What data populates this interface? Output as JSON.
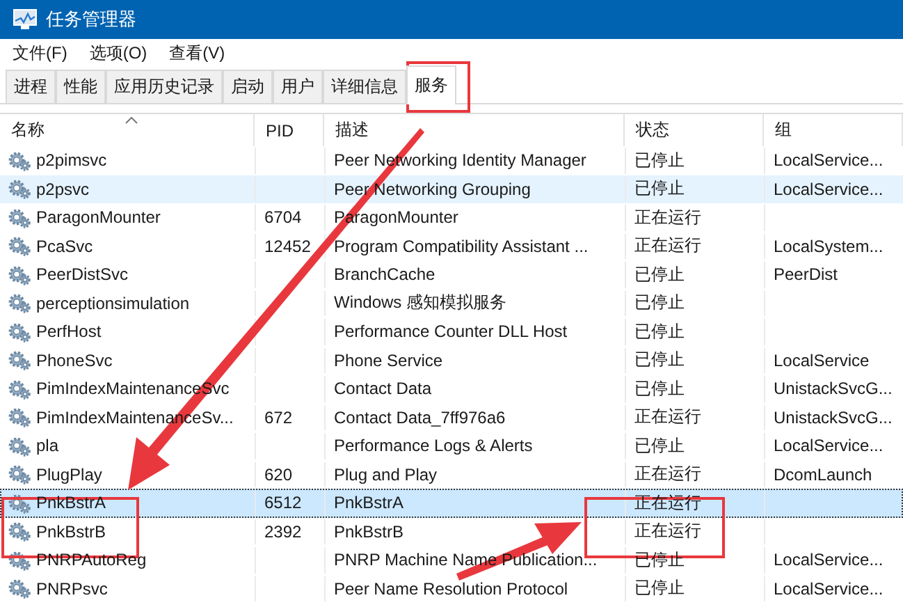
{
  "window": {
    "title": "任务管理器"
  },
  "menu": [
    "文件(F)",
    "选项(O)",
    "查看(V)"
  ],
  "tabs": [
    {
      "label": "进程",
      "selected": false
    },
    {
      "label": "性能",
      "selected": false
    },
    {
      "label": "应用历史记录",
      "selected": false
    },
    {
      "label": "启动",
      "selected": false
    },
    {
      "label": "用户",
      "selected": false
    },
    {
      "label": "详细信息",
      "selected": false
    },
    {
      "label": "服务",
      "selected": true
    }
  ],
  "table": {
    "columns": [
      "名称",
      "PID",
      "描述",
      "状态",
      "组"
    ],
    "rows": [
      {
        "name": "p2pimsvc",
        "pid": "",
        "description": "Peer Networking Identity Manager",
        "status": "已停止",
        "group": "LocalService...",
        "selected": false,
        "hovered": false
      },
      {
        "name": "p2psvc",
        "pid": "",
        "description": "Peer Networking Grouping",
        "status": "已停止",
        "group": "LocalService...",
        "selected": false,
        "hovered": true
      },
      {
        "name": "ParagonMounter",
        "pid": "6704",
        "description": "ParagonMounter",
        "status": "正在运行",
        "group": "",
        "selected": false,
        "hovered": false
      },
      {
        "name": "PcaSvc",
        "pid": "12452",
        "description": "Program Compatibility Assistant ...",
        "status": "正在运行",
        "group": "LocalSystem...",
        "selected": false,
        "hovered": false
      },
      {
        "name": "PeerDistSvc",
        "pid": "",
        "description": "BranchCache",
        "status": "已停止",
        "group": "PeerDist",
        "selected": false,
        "hovered": false
      },
      {
        "name": "perceptionsimulation",
        "pid": "",
        "description": "Windows 感知模拟服务",
        "status": "已停止",
        "group": "",
        "selected": false,
        "hovered": false
      },
      {
        "name": "PerfHost",
        "pid": "",
        "description": "Performance Counter DLL Host",
        "status": "已停止",
        "group": "",
        "selected": false,
        "hovered": false
      },
      {
        "name": "PhoneSvc",
        "pid": "",
        "description": "Phone Service",
        "status": "已停止",
        "group": "LocalService",
        "selected": false,
        "hovered": false
      },
      {
        "name": "PimIndexMaintenanceSvc",
        "pid": "",
        "description": "Contact Data",
        "status": "已停止",
        "group": "UnistackSvcG...",
        "selected": false,
        "hovered": false
      },
      {
        "name": "PimIndexMaintenanceSv...",
        "pid": "672",
        "description": "Contact Data_7ff976a6",
        "status": "正在运行",
        "group": "UnistackSvcG...",
        "selected": false,
        "hovered": false
      },
      {
        "name": "pla",
        "pid": "",
        "description": "Performance Logs & Alerts",
        "status": "已停止",
        "group": "LocalService...",
        "selected": false,
        "hovered": false
      },
      {
        "name": "PlugPlay",
        "pid": "620",
        "description": "Plug and Play",
        "status": "正在运行",
        "group": "DcomLaunch",
        "selected": false,
        "hovered": false
      },
      {
        "name": "PnkBstrA",
        "pid": "6512",
        "description": "PnkBstrA",
        "status": "正在运行",
        "group": "",
        "selected": true,
        "hovered": false
      },
      {
        "name": "PnkBstrB",
        "pid": "2392",
        "description": "PnkBstrB",
        "status": "正在运行",
        "group": "",
        "selected": false,
        "hovered": false
      },
      {
        "name": "PNRPAutoReg",
        "pid": "",
        "description": "PNRP Machine Name Publication...",
        "status": "已停止",
        "group": "LocalService...",
        "selected": false,
        "hovered": false
      },
      {
        "name": "PNRPsvc",
        "pid": "",
        "description": "Peer Name Resolution Protocol",
        "status": "已停止",
        "group": "LocalService...",
        "selected": false,
        "hovered": false
      }
    ]
  }
}
